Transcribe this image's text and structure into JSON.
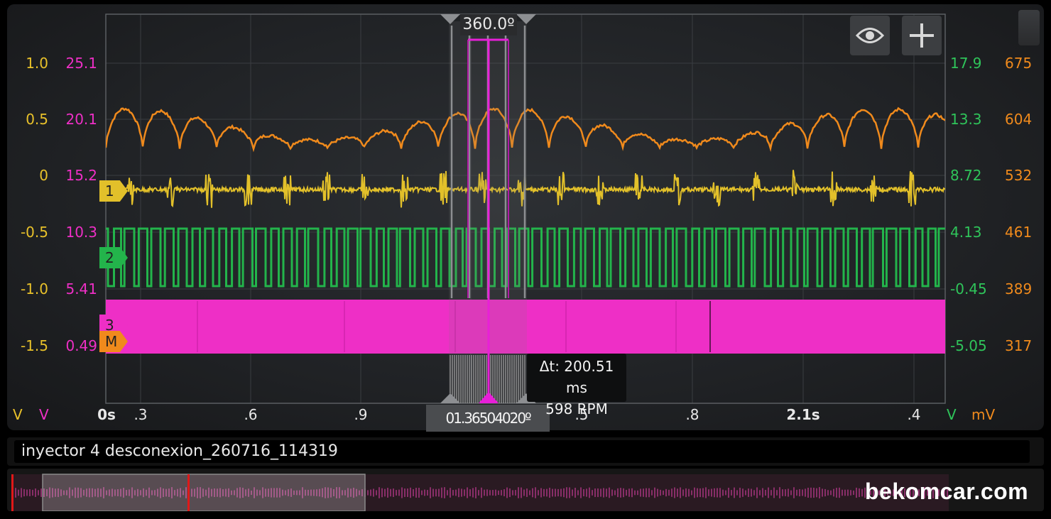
{
  "toolbar": {
    "eye_icon": "eye-icon",
    "plus_icon": "plus-icon"
  },
  "axes": {
    "left_outer": [
      "1.0",
      "0.5",
      "0",
      "-0.5",
      "-1.0",
      "-1.5"
    ],
    "left_inner": [
      "25.1",
      "20.1",
      "15.2",
      "10.3",
      "5.41",
      "0.49"
    ],
    "right_inner": [
      "17.9",
      "13.3",
      "8.72",
      "4.13",
      "-0.45",
      "-5.05"
    ],
    "right_outer": [
      "675",
      "604",
      "532",
      "461",
      "389",
      "317"
    ],
    "x_ticks": [
      "0s",
      ".3",
      ".6",
      ".9",
      ".5",
      ".8",
      "2.1s",
      ".4"
    ],
    "units": {
      "left_outer": "V",
      "left_inner": "V",
      "right_inner": "V",
      "right_outer": "mV"
    }
  },
  "channels": {
    "ch1": {
      "label": "1",
      "color": "#e2c02a"
    },
    "ch2": {
      "label": "2",
      "color": "#23b44b"
    },
    "ch3": {
      "label": "3",
      "color": "#ee2fc6"
    },
    "math": {
      "label": "M",
      "color": "#f08a1c"
    }
  },
  "cursor": {
    "angle": "360.0º",
    "bottom_overlap_text": "01.36504020º",
    "delta_t": "Δt: 200.51 ms",
    "rpm": "598 RPM"
  },
  "file": {
    "name": "inyector 4 desconexion_260716_114319"
  },
  "watermark": "bekomcar.com"
}
